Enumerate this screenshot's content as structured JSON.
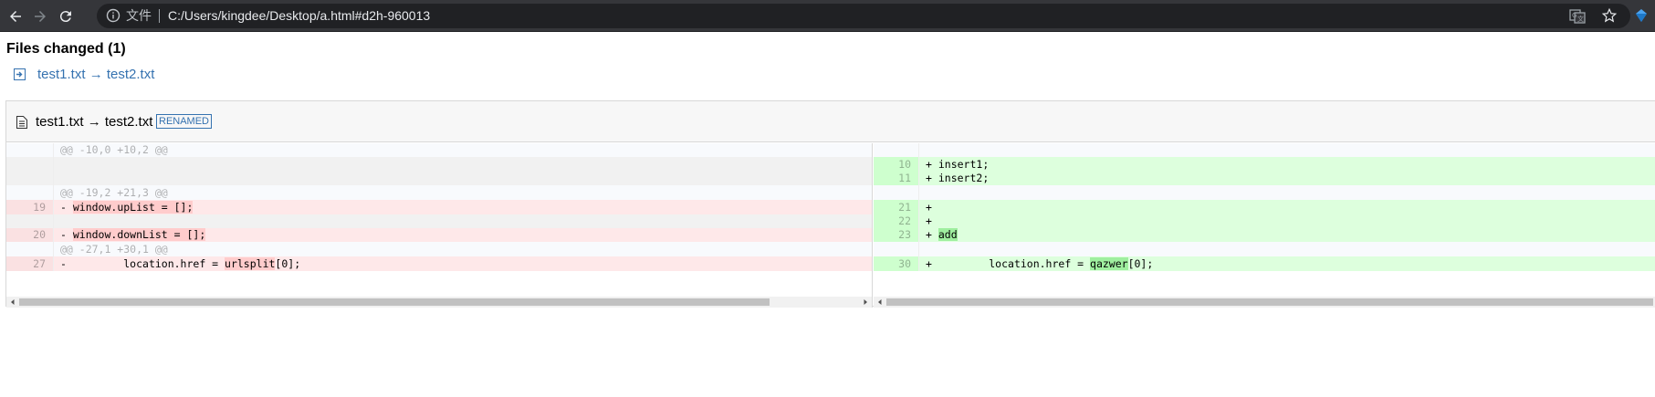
{
  "browser": {
    "scheme_label": "文件",
    "url": "C:/Users/kingdee/Desktop/a.html#d2h-960013",
    "icons": [
      "back-icon",
      "forward-icon",
      "reload-icon",
      "info-icon",
      "translate-icon",
      "star-icon",
      "extension-icon"
    ]
  },
  "page": {
    "files_changed_title": "Files changed (1)",
    "file_list": [
      {
        "label": "test1.txt → test2.txt"
      }
    ]
  },
  "diff": {
    "file_name": "test1.txt → test2.txt",
    "tag": "RENAMED",
    "left": [
      {
        "type": "info",
        "ln": "",
        "prefix": "",
        "pre": "@@ -10,0 +10,2 @@",
        "hl": "",
        "post": ""
      },
      {
        "type": "empty",
        "ln": "",
        "prefix": "",
        "pre": "",
        "hl": "",
        "post": ""
      },
      {
        "type": "empty",
        "ln": "",
        "prefix": "",
        "pre": "",
        "hl": "",
        "post": ""
      },
      {
        "type": "info",
        "ln": "",
        "prefix": "",
        "pre": "@@ -19,2 +21,3 @@",
        "hl": "",
        "post": ""
      },
      {
        "type": "del",
        "ln": "19",
        "prefix": "- ",
        "pre": "",
        "hl": "window.upList = [];",
        "post": ""
      },
      {
        "type": "empty",
        "ln": "",
        "prefix": "",
        "pre": "",
        "hl": "",
        "post": ""
      },
      {
        "type": "del",
        "ln": "20",
        "prefix": "- ",
        "pre": "",
        "hl": "window.downList = [];",
        "post": ""
      },
      {
        "type": "info",
        "ln": "",
        "prefix": "",
        "pre": "@@ -27,1 +30,1 @@",
        "hl": "",
        "post": ""
      },
      {
        "type": "del",
        "ln": "27",
        "prefix": "- ",
        "pre": "        location.href = ",
        "hl": "urlsplit",
        "post": "[0];"
      }
    ],
    "right": [
      {
        "type": "info",
        "ln": "",
        "prefix": "",
        "pre": "",
        "hl": "",
        "post": ""
      },
      {
        "type": "ins",
        "ln": "10",
        "prefix": "+ ",
        "pre": "insert1;",
        "hl": "",
        "post": ""
      },
      {
        "type": "ins",
        "ln": "11",
        "prefix": "+ ",
        "pre": "insert2;",
        "hl": "",
        "post": ""
      },
      {
        "type": "info",
        "ln": "",
        "prefix": "",
        "pre": "",
        "hl": "",
        "post": ""
      },
      {
        "type": "ins",
        "ln": "21",
        "prefix": "+ ",
        "pre": "",
        "hl": "",
        "post": ""
      },
      {
        "type": "ins",
        "ln": "22",
        "prefix": "+ ",
        "pre": "",
        "hl": "",
        "post": ""
      },
      {
        "type": "ins",
        "ln": "23",
        "prefix": "+ ",
        "pre": "",
        "hl": "add",
        "post": ""
      },
      {
        "type": "info",
        "ln": "",
        "prefix": "",
        "pre": "",
        "hl": "",
        "post": ""
      },
      {
        "type": "ins",
        "ln": "30",
        "prefix": "+ ",
        "pre": "        location.href = ",
        "hl": "qazwer",
        "post": "[0];"
      }
    ]
  },
  "colors": {
    "chrome_bg": "#35363a",
    "omnibox_bg": "#202124",
    "link": "#3572b0",
    "deletion_bg": "#fee8e9",
    "deletion_highlight": "#ffcccc",
    "insertion_bg": "#ddffdd",
    "insertion_highlight": "#9fef9f"
  }
}
